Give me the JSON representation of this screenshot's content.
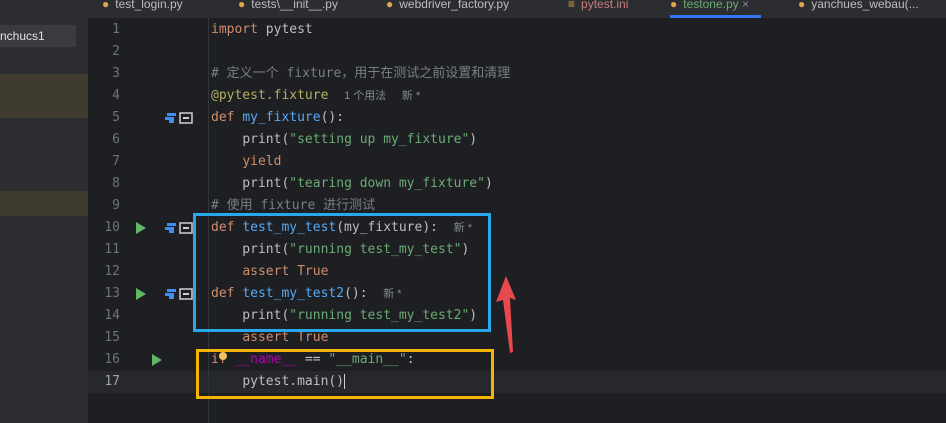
{
  "tabs": [
    {
      "label": "test_login.py",
      "icon": "python-file-icon"
    },
    {
      "label": "tests\\__init__.py",
      "icon": "python-file-icon"
    },
    {
      "label": "webdriver_factory.py",
      "icon": "python-file-icon"
    },
    {
      "label": "pytest.ini",
      "icon": "ini-file-icon"
    },
    {
      "label": "testone.py",
      "icon": "python-file-icon",
      "active": true,
      "close": "×"
    },
    {
      "label": "yanchues_webau(...",
      "icon": "python-file-icon"
    }
  ],
  "sidebar": {
    "item_label": "nchucs1"
  },
  "editor": {
    "line_numbers": [
      "1",
      "2",
      "3",
      "4",
      "5",
      "6",
      "7",
      "8",
      "9",
      "10",
      "11",
      "12",
      "13",
      "14",
      "15",
      "16",
      "17"
    ],
    "hints": {
      "fixture_usage": "1 个用法",
      "new": "新 *"
    },
    "lines": {
      "l1": "import pytest",
      "l3": "# 定义一个 fixture，用于在测试之前设置和清理",
      "l4": "@pytest.fixture",
      "l5_def": "def",
      "l5_fn": "my_fixture",
      "l5_rest": "():",
      "l6_print": "print(",
      "l6_str": "\"setting up my_fixture\"",
      "l7": "yield",
      "l8_str": "\"tearing down my_fixture\"",
      "l9": "# 使用 fixture 进行测试",
      "l10_fn": "test_my_test",
      "l10_rest": "(my_fixture):",
      "l11_str": "\"running test_my_test\"",
      "l12_kw": "assert",
      "l12_val": "True",
      "l13_fn": "test_my_test2",
      "l13_rest": "():",
      "l14_str": "\"running test_my_test2\"",
      "l15": "assert True",
      "l16_if": "if",
      "l16_name": "__name__",
      "l16_eq": " == ",
      "l16_str": "\"__main__\"",
      "l16_colon": ":",
      "l17": "pytest.main()"
    }
  },
  "annotations": {
    "blue_box_color": "#29a8ee",
    "yellow_box_color": "#f4b400",
    "arrow_color": "#e8494f"
  }
}
